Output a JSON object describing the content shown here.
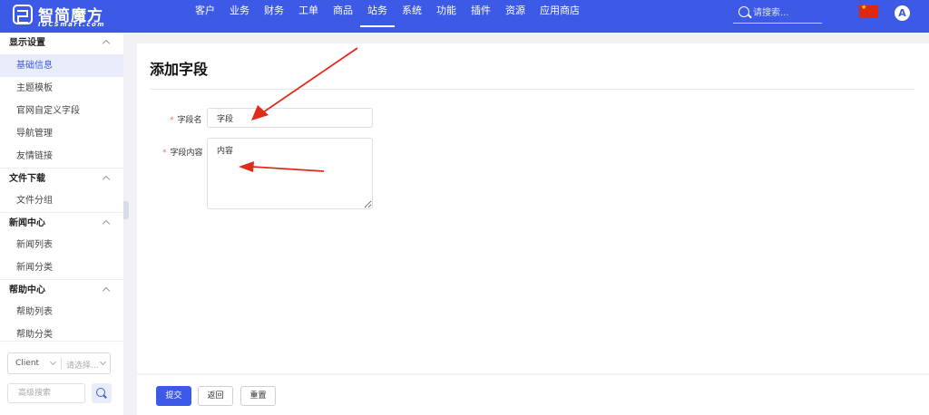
{
  "brand": {
    "name": "智简魔方",
    "sub": "IDCSmart.com"
  },
  "nav": [
    "客户",
    "业务",
    "财务",
    "工单",
    "商品",
    "站务",
    "系统",
    "功能",
    "插件",
    "资源",
    "应用商店"
  ],
  "nav_active": "站务",
  "search": {
    "placeholder": "请搜索..."
  },
  "avatar_initial": "A",
  "sidebar": {
    "groups": [
      {
        "title": "显示设置",
        "items": [
          "基础信息",
          "主题模板",
          "官网自定义字段",
          "导航管理",
          "友情链接"
        ]
      },
      {
        "title": "文件下载",
        "items": [
          "文件分组"
        ]
      },
      {
        "title": "新闻中心",
        "items": [
          "新闻列表",
          "新闻分类"
        ]
      },
      {
        "title": "帮助中心",
        "items": [
          "帮助列表",
          "帮助分类"
        ]
      }
    ],
    "active_item": "基础信息",
    "client_select": "Client",
    "secondary_placeholder": "请选择...",
    "adv_search_placeholder": "高级搜索"
  },
  "page": {
    "title": "添加字段",
    "field_name_label": "字段名",
    "field_name_value": "字段",
    "field_content_label": "字段内容",
    "field_content_value": "内容"
  },
  "buttons": {
    "submit": "提交",
    "back": "返回",
    "reset": "重置"
  },
  "colors": {
    "brand": "#3d5ae6",
    "required": "#f56c6c",
    "annotation": "#e02a1c"
  }
}
